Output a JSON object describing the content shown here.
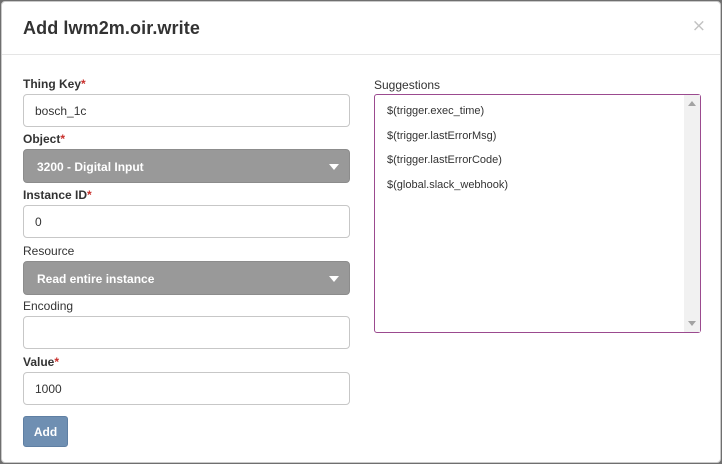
{
  "modal": {
    "title": "Add lwm2m.oir.write",
    "close_icon": "close-icon",
    "close_glyph": "×"
  },
  "form": {
    "thing_key": {
      "label": "Thing Key",
      "required_mark": "*",
      "value": "bosch_1c"
    },
    "object": {
      "label": "Object",
      "required_mark": "*",
      "selected": "3200 - Digital Input"
    },
    "instance_id": {
      "label": "Instance ID",
      "required_mark": "*",
      "value": "0"
    },
    "resource": {
      "label": "Resource",
      "selected": "Read entire instance"
    },
    "encoding": {
      "label": "Encoding",
      "value": ""
    },
    "value": {
      "label": "Value",
      "required_mark": "*",
      "value": "1000"
    },
    "add_label": "Add"
  },
  "suggestions": {
    "label": "Suggestions",
    "items": [
      "$(trigger.exec_time)",
      "$(trigger.lastErrorMsg)",
      "$(trigger.lastErrorCode)",
      "$(global.slack_webhook)"
    ]
  },
  "colors": {
    "required": "#c9302c",
    "select_bg": "#999999",
    "button_bg": "#6f8fb2",
    "suggestions_border": "#9b4a8f"
  }
}
